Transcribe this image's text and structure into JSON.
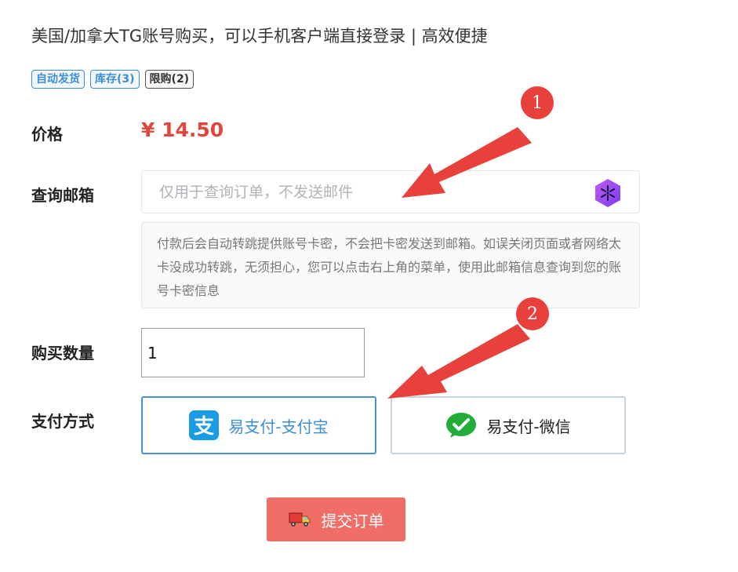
{
  "product": {
    "title": "美国/加拿大TG账号购买，可以手机客户端直接登录 | 高效便捷",
    "badges": [
      {
        "label": "自动发货",
        "style": "blue"
      },
      {
        "label": "库存(3)",
        "style": "blue"
      },
      {
        "label": "限购(2)",
        "style": "dark"
      }
    ]
  },
  "form": {
    "price_label": "价格",
    "price_value": "¥ 14.50",
    "email_label": "查询邮箱",
    "email_placeholder": "仅用于查询订单，不发送邮件",
    "email_value": "",
    "notice": "付款后会自动转跳提供账号卡密，不会把卡密发送到邮箱。如误关闭页面或者网络太卡没成功转跳，无须担心，您可以点击右上角的菜单，使用此邮箱信息查询到您的账号卡密信息",
    "quantity_label": "购买数量",
    "quantity_value": "1",
    "payment_label": "支付方式",
    "payment_options": [
      {
        "label": "易支付-支付宝",
        "icon": "alipay-icon",
        "selected": true
      },
      {
        "label": "易支付-微信",
        "icon": "wechat-pay-icon",
        "selected": false
      }
    ],
    "submit_label": "提交订单",
    "submit_icon": "delivery-truck-icon"
  },
  "annotations": {
    "markers": [
      "1",
      "2"
    ],
    "color": "#e8403a"
  },
  "colors": {
    "accent": "#3b8ed6",
    "price": "#e0463c",
    "submit": "#f16d68"
  }
}
